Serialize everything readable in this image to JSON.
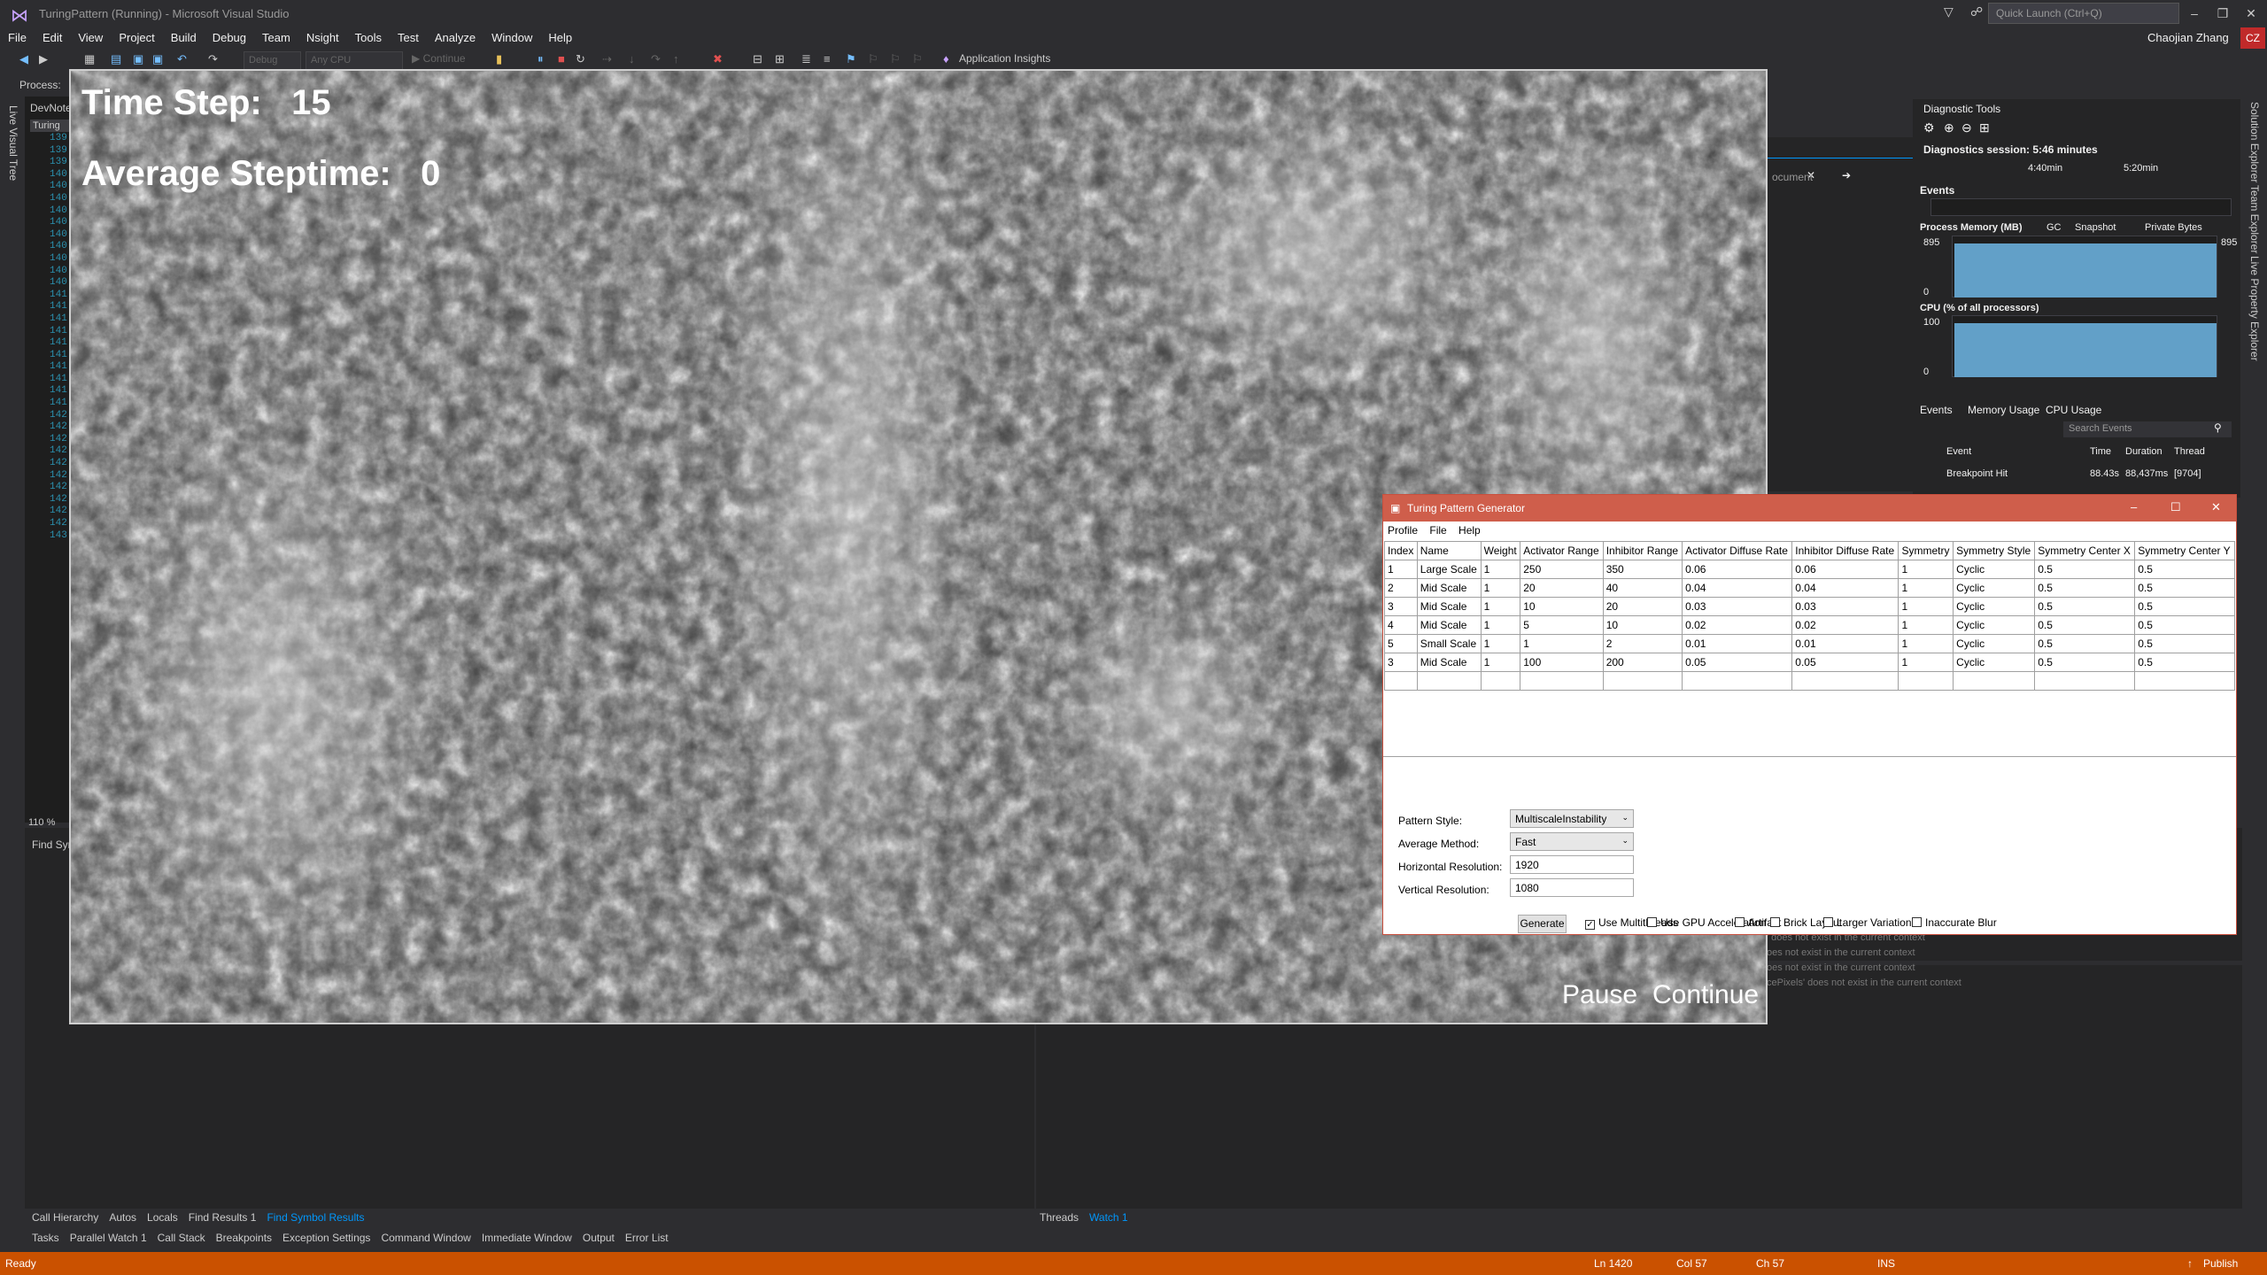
{
  "window": {
    "title": "TuringPattern (Running) - Microsoft Visual Studio",
    "quick_launch": "Quick Launch (Ctrl+Q)",
    "user": "Chaojian Zhang",
    "avatar": "CZ"
  },
  "menu": [
    "File",
    "Edit",
    "View",
    "Project",
    "Build",
    "Debug",
    "Team",
    "Nsight",
    "Tools",
    "Test",
    "Analyze",
    "Window",
    "Help"
  ],
  "toolbar": {
    "config": "Debug",
    "platform": "Any CPU",
    "continue": "Continue",
    "insights": "Application Insights"
  },
  "process_label": "Process:",
  "left_strip": "Live Visual Tree",
  "editor": {
    "tab": "DevNote",
    "file": "Turing",
    "zoom": "110 %",
    "find": "Find Sym",
    "lines": [
      "139",
      "139",
      "139",
      "140",
      "140",
      "140",
      "140",
      "140",
      "140",
      "140",
      "140",
      "140",
      "140",
      "141",
      "141",
      "141",
      "141",
      "141",
      "141",
      "141",
      "141",
      "141",
      "141",
      "142",
      "142",
      "142",
      "142",
      "142",
      "142",
      "142",
      "142",
      "142",
      "142",
      "143"
    ]
  },
  "render": {
    "time_step_label": "Time Step:",
    "time_step_value": "15",
    "avg_label": "Average Steptime:",
    "avg_value": "0",
    "pause": "Pause",
    "continue": "Continue"
  },
  "diagnostics": {
    "title": "Diagnostic Tools",
    "session": "Diagnostics session: 5:46 minutes",
    "t1": "4:40min",
    "t2": "5:20min",
    "events": "Events",
    "memory": "Process Memory (MB)",
    "gc": "GC",
    "snapshot": "Snapshot",
    "private": "Private Bytes",
    "mem_max": "895",
    "mem_min": "0",
    "cpu": "CPU (% of all processors)",
    "cpu_max": "100",
    "cpu_min": "0",
    "tabs": [
      "Events",
      "Memory Usage",
      "CPU Usage"
    ],
    "search": "Search Events",
    "cols": [
      "Event",
      "Time",
      "Duration",
      "Thread"
    ],
    "row": [
      "Breakpoint Hit",
      "88.43s",
      "88,437ms",
      "[9704]"
    ]
  },
  "mid_panel": {
    "doc": "ocument"
  },
  "right_strip": [
    "Solution Explorer",
    "Team Explorer",
    "Live Property Explorer"
  ],
  "context_msgs": [
    "' does not exist in the current context",
    "oes not exist in the current context",
    "oes not exist in the current context",
    "cePixels' does not exist in the current context"
  ],
  "tpg": {
    "title": "Turing Pattern Generator",
    "menu": [
      "Profile",
      "File",
      "Help"
    ],
    "columns": [
      "Index",
      "Name",
      "Weight",
      "Activator Range",
      "Inhibitor Range",
      "Activator Diffuse Rate",
      "Inhibitor Diffuse Rate",
      "Symmetry",
      "Symmetry Style",
      "Symmetry Center X",
      "Symmetry Center Y"
    ],
    "rows": [
      [
        "1",
        "Large Scale",
        "1",
        "250",
        "350",
        "0.06",
        "0.06",
        "1",
        "Cyclic",
        "0.5",
        "0.5"
      ],
      [
        "2",
        "Mid Scale",
        "1",
        "20",
        "40",
        "0.04",
        "0.04",
        "1",
        "Cyclic",
        "0.5",
        "0.5"
      ],
      [
        "3",
        "Mid Scale",
        "1",
        "10",
        "20",
        "0.03",
        "0.03",
        "1",
        "Cyclic",
        "0.5",
        "0.5"
      ],
      [
        "4",
        "Mid Scale",
        "1",
        "5",
        "10",
        "0.02",
        "0.02",
        "1",
        "Cyclic",
        "0.5",
        "0.5"
      ],
      [
        "5",
        "Small Scale",
        "1",
        "1",
        "2",
        "0.01",
        "0.01",
        "1",
        "Cyclic",
        "0.5",
        "0.5"
      ],
      [
        "3",
        "Mid Scale",
        "1",
        "100",
        "200",
        "0.05",
        "0.05",
        "1",
        "Cyclic",
        "0.5",
        "0.5"
      ]
    ],
    "pattern_style_label": "Pattern Style:",
    "pattern_style": "MultiscaleInstability",
    "avg_method_label": "Average Method:",
    "avg_method": "Fast",
    "hres_label": "Horizontal Resolution:",
    "hres": "1920",
    "vres_label": "Vertical Resolution:",
    "vres": "1080",
    "generate": "Generate",
    "checks": [
      {
        "label": "Use Multithreads",
        "checked": true
      },
      {
        "label": "Use GPU Acceleration",
        "checked": false
      },
      {
        "label": "Artifact",
        "checked": false
      },
      {
        "label": "Brick Layout",
        "checked": false
      },
      {
        "label": "Larger Variation",
        "checked": false
      },
      {
        "label": "Inaccurate Blur",
        "checked": false
      }
    ]
  },
  "bottom_tabs_a": [
    "Call Hierarchy",
    "Autos",
    "Locals",
    "Find Results 1",
    "Find Symbol Results"
  ],
  "bottom_tabs_a_active": "Find Symbol Results",
  "bottom_tabs_b": [
    "Tasks",
    "Parallel Watch 1",
    "Call Stack",
    "Breakpoints",
    "Exception Settings",
    "Command Window",
    "Immediate Window",
    "Output",
    "Error List"
  ],
  "bottom_tabs_c": [
    "Threads",
    "Watch 1"
  ],
  "status": {
    "ready": "Ready",
    "ln": "Ln 1420",
    "col": "Col 57",
    "ch": "Ch 57",
    "ins": "INS",
    "publish": "Publish"
  }
}
